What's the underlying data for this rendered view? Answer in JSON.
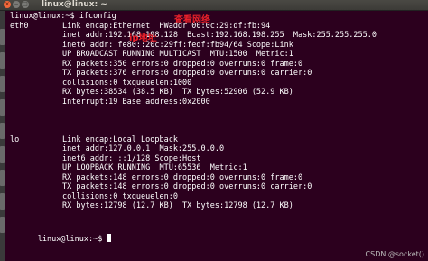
{
  "window": {
    "title": "linux@linux: ~",
    "close_glyph": "×",
    "min_glyph": "−",
    "max_glyph": "□"
  },
  "terminal": {
    "prompt1": "linux@linux:~$ ifconfig",
    "eth0_name": "eth0",
    "eth0_lines": [
      "Link encap:Ethernet  HWaddr 00:0c:29:df:fb:94",
      "inet addr:192.168.198.128  Bcast:192.168.198.255  Mask:255.255.255.0",
      "inet6 addr: fe80::20c:29ff:fedf:fb94/64 Scope:Link",
      "UP BROADCAST RUNNING MULTICAST  MTU:1500  Metric:1",
      "RX packets:350 errors:0 dropped:0 overruns:0 frame:0",
      "TX packets:376 errors:0 dropped:0 overruns:0 carrier:0",
      "collisions:0 txqueuelen:1000",
      "RX bytes:38534 (38.5 KB)  TX bytes:52906 (52.9 KB)",
      "Interrupt:19 Base address:0x2000"
    ],
    "lo_name": "lo",
    "lo_lines": [
      "Link encap:Local Loopback",
      "inet addr:127.0.0.1  Mask:255.0.0.0",
      "inet6 addr: ::1/128 Scope:Host",
      "UP LOOPBACK RUNNING  MTU:65536  Metric:1",
      "RX packets:148 errors:0 dropped:0 overruns:0 frame:0",
      "TX packets:148 errors:0 dropped:0 overruns:0 carrier:0",
      "collisions:0 txqueuelen:0",
      "RX bytes:12798 (12.7 KB)  TX bytes:12798 (12.7 KB)"
    ],
    "prompt2": "linux@linux:~$ "
  },
  "annotations": {
    "check_network": "查看网络",
    "ip_address": "ip地址"
  },
  "watermark": "CSDN @socket()",
  "colors": {
    "background": "#2c001e",
    "text": "#ffffff",
    "annotation": "#e8202a"
  }
}
